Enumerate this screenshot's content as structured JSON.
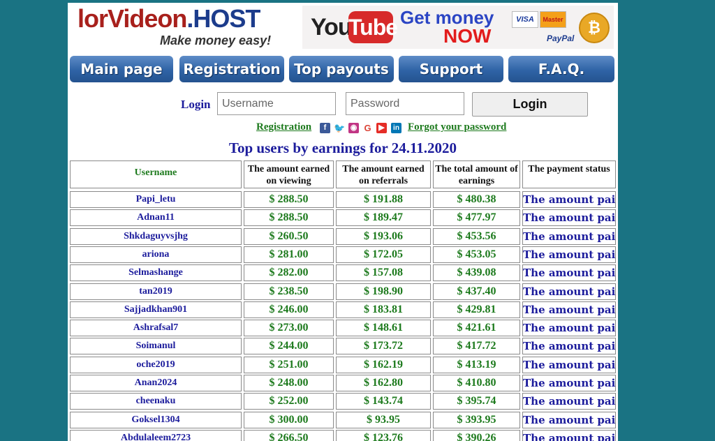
{
  "header": {
    "logo_main": "lorVideon",
    "logo_host": ".HOST",
    "logo_tagline": "Make money easy!",
    "banner": {
      "you": "You",
      "tube": "Tube",
      "get_money": "Get money",
      "now": "NOW",
      "card_visa": "VISA",
      "card_mastercard": "Master",
      "paypal": "PayPal",
      "coin": "₿"
    }
  },
  "nav": {
    "items": [
      {
        "label": "Main page"
      },
      {
        "label": "Registration"
      },
      {
        "label": "Top payouts"
      },
      {
        "label": "Support"
      },
      {
        "label": "F.A.Q."
      }
    ]
  },
  "login": {
    "label": "Login",
    "username_placeholder": "Username",
    "password_placeholder": "Password",
    "button": "Login",
    "registration_link": "Registration",
    "forgot_link": "Forgot your password"
  },
  "table": {
    "title": "Top users by earnings for 24.11.2020",
    "headers": [
      "Username",
      "The amount earned on viewing",
      "The amount earned on referrals",
      "The total amount of earnings",
      "The payment status"
    ],
    "rows": [
      [
        "Papi_letu",
        "$ 288.50",
        "$ 191.88",
        "$ 480.38",
        "The amount paid"
      ],
      [
        "Adnan11",
        "$ 288.50",
        "$ 189.47",
        "$ 477.97",
        "The amount paid"
      ],
      [
        "Shkdaguyvsjhg",
        "$ 260.50",
        "$ 193.06",
        "$ 453.56",
        "The amount paid"
      ],
      [
        "ariona",
        "$ 281.00",
        "$ 172.05",
        "$ 453.05",
        "The amount paid"
      ],
      [
        "Selmashange",
        "$ 282.00",
        "$ 157.08",
        "$ 439.08",
        "The amount paid"
      ],
      [
        "tan2019",
        "$ 238.50",
        "$ 198.90",
        "$ 437.40",
        "The amount paid"
      ],
      [
        "Sajjadkhan901",
        "$ 246.00",
        "$ 183.81",
        "$ 429.81",
        "The amount paid"
      ],
      [
        "Ashrafsal7",
        "$ 273.00",
        "$ 148.61",
        "$ 421.61",
        "The amount paid"
      ],
      [
        "Soimanul",
        "$ 244.00",
        "$ 173.72",
        "$ 417.72",
        "The amount paid"
      ],
      [
        "oche2019",
        "$ 251.00",
        "$ 162.19",
        "$ 413.19",
        "The amount paid"
      ],
      [
        "Anan2024",
        "$ 248.00",
        "$ 162.80",
        "$ 410.80",
        "The amount paid"
      ],
      [
        "cheenaku",
        "$ 252.00",
        "$ 143.74",
        "$ 395.74",
        "The amount paid"
      ],
      [
        "Goksel1304",
        "$ 300.00",
        "$ 93.95",
        "$ 393.95",
        "The amount paid"
      ],
      [
        "Abdulaleem2723",
        "$ 266.50",
        "$ 123.76",
        "$ 390.26",
        "The amount paid"
      ]
    ]
  },
  "social_icons": [
    "facebook-icon",
    "twitter-icon",
    "instagram-icon",
    "google-icon",
    "youtube-icon",
    "linkedin-icon"
  ],
  "colors": {
    "background": "#1a7383",
    "nav_button": "#2f63a6",
    "link_green": "#1d7a1d",
    "text_blue": "#1c1c9c"
  }
}
